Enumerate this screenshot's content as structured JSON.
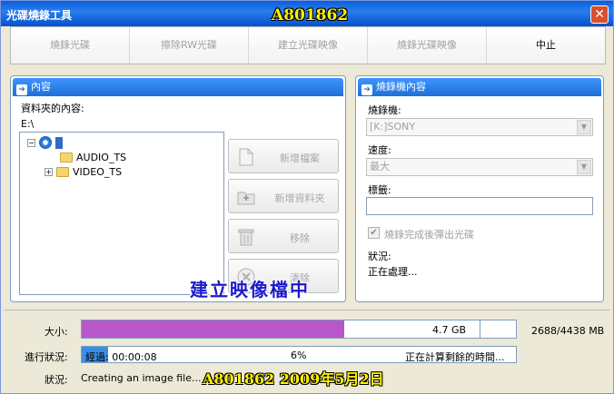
{
  "window": {
    "title": "光碟燒錄工具",
    "watermark_title": "A801862",
    "close_glyph": "✕"
  },
  "toolbar": {
    "buttons": [
      "燒錄光碟",
      "擦除RW光碟",
      "建立光碟映像",
      "燒錄光碟映像",
      "中止"
    ]
  },
  "content_panel": {
    "header": "內容",
    "folder_contents_label": "資料夾的內容:",
    "path": "E:\\",
    "tree": [
      {
        "label": "",
        "kind": "drive",
        "expander": "−"
      },
      {
        "label": "AUDIO_TS",
        "kind": "folder",
        "expander": ""
      },
      {
        "label": "VIDEO_TS",
        "kind": "folder",
        "expander": "+"
      }
    ],
    "buttons": [
      "新增檔案",
      "新增資料夾",
      "移除",
      "清除"
    ],
    "overlay_text": "建立映像檔中"
  },
  "burner_panel": {
    "header": "燒錄機內容",
    "burner_label": "燒錄機:",
    "burner_value": "[K:]SONY",
    "speed_label": "速度:",
    "speed_value": "最大",
    "label_label": "標籤:",
    "label_value": "",
    "eject_checkbox_label": "燒錄完成後彈出光碟",
    "eject_checked": true,
    "status_label": "狀況:",
    "status_value": "正在處理..."
  },
  "bottom": {
    "size_label": "大小:",
    "size_bar_text": "4.7 GB",
    "size_fill_fraction": 0.605,
    "size_fill_color": "#b858c8",
    "size_readout": "2688/4438  MB",
    "progress_label": "進行狀況:",
    "elapsed_text": "經過: 00:00:08",
    "percent_text": "6%",
    "remaining_text": "正在計算剩餘的時間...",
    "progress_fraction": 0.06,
    "progress_fill_color": "#3a8ee8",
    "status_label": "狀況:",
    "status_value": "Creating an image file...",
    "watermark_stamp": "A801862   2009年5月2日"
  }
}
